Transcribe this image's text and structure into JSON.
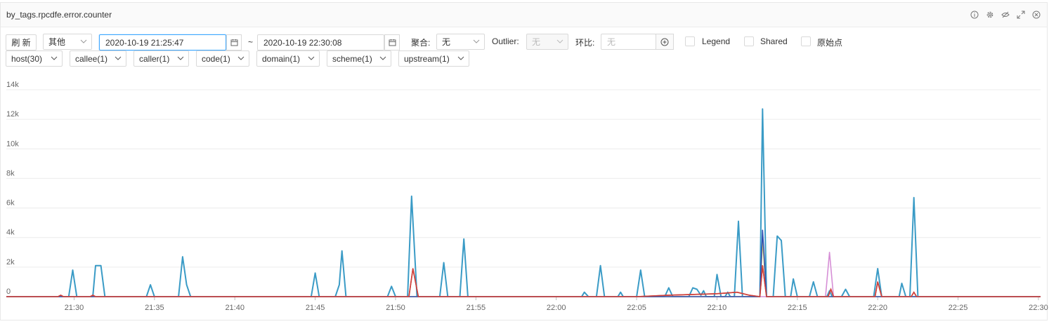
{
  "panel": {
    "title": "by_tags.rpcdfe.error.counter",
    "header_icons": [
      "info-icon",
      "gear-icon",
      "eye-off-icon",
      "expand-icon",
      "close-icon"
    ]
  },
  "toolbar": {
    "refresh_label": "刷 新",
    "type_select": "其他",
    "start_time": "2020-10-19 21:25:47",
    "separator": "~",
    "end_time": "2020-10-19 22:30:08",
    "agg_label": "聚合:",
    "agg_value": "无",
    "outlier_label": "Outlier:",
    "outlier_value": "无",
    "ratio_label": "环比:",
    "ratio_placeholder": "无",
    "legend_label": "Legend",
    "shared_label": "Shared",
    "raw_label": "原始点"
  },
  "filters": [
    "host(30)",
    "callee(1)",
    "caller(1)",
    "code(1)",
    "domain(1)",
    "scheme(1)",
    "upstream(1)"
  ],
  "colors": {
    "accent": "#40a9ff",
    "series_blue": "#3a9bc6",
    "series_red": "#d0403a",
    "series_pink": "#d68fd6",
    "series_yellow": "#e8d05a",
    "grid": "#ececec"
  },
  "chart_data": {
    "type": "line",
    "y_ticks": [
      "0",
      "2k",
      "4k",
      "6k",
      "8k",
      "10k",
      "12k",
      "14k"
    ],
    "x_ticks": [
      "21:30",
      "21:35",
      "21:40",
      "21:45",
      "21:50",
      "21:55",
      "22:00",
      "22:05",
      "22:10",
      "22:15",
      "22:20",
      "22:25",
      "22:30"
    ],
    "xlim": [
      "21:25:47",
      "22:30:08"
    ],
    "ylim": [
      0,
      14000
    ],
    "grid": true,
    "series": [
      {
        "color": "#3a9bc6",
        "points": [
          [
            "21:25:47",
            0
          ],
          [
            "21:29:40",
            0
          ],
          [
            "21:29:55",
            1800
          ],
          [
            "21:30:10",
            0
          ],
          [
            "21:31:10",
            0
          ],
          [
            "21:31:20",
            2100
          ],
          [
            "21:31:40",
            2100
          ],
          [
            "21:31:55",
            0
          ],
          [
            "21:34:30",
            0
          ],
          [
            "21:34:45",
            800
          ],
          [
            "21:35:00",
            0
          ],
          [
            "21:36:30",
            0
          ],
          [
            "21:36:45",
            2700
          ],
          [
            "21:37:00",
            800
          ],
          [
            "21:37:15",
            0
          ],
          [
            "21:44:45",
            0
          ],
          [
            "21:45:00",
            1600
          ],
          [
            "21:45:15",
            0
          ],
          [
            "21:46:15",
            0
          ],
          [
            "21:46:30",
            800
          ],
          [
            "21:46:40",
            3100
          ],
          [
            "21:46:55",
            0
          ],
          [
            "21:49:30",
            0
          ],
          [
            "21:49:45",
            700
          ],
          [
            "21:50:00",
            0
          ],
          [
            "21:50:45",
            0
          ],
          [
            "21:51:00",
            6800
          ],
          [
            "21:51:20",
            0
          ],
          [
            "21:52:45",
            0
          ],
          [
            "21:53:00",
            2300
          ],
          [
            "21:53:15",
            0
          ],
          [
            "21:54:00",
            0
          ],
          [
            "21:54:15",
            3900
          ],
          [
            "21:54:30",
            0
          ],
          [
            "22:01:35",
            0
          ],
          [
            "22:01:45",
            300
          ],
          [
            "22:02:00",
            0
          ],
          [
            "22:02:30",
            0
          ],
          [
            "22:02:45",
            2100
          ],
          [
            "22:03:00",
            0
          ],
          [
            "22:03:50",
            0
          ],
          [
            "22:04:00",
            300
          ],
          [
            "22:04:10",
            0
          ],
          [
            "22:05:00",
            0
          ],
          [
            "22:05:15",
            1800
          ],
          [
            "22:05:30",
            0
          ],
          [
            "22:06:45",
            0
          ],
          [
            "22:07:00",
            600
          ],
          [
            "22:07:15",
            0
          ],
          [
            "22:08:15",
            0
          ],
          [
            "22:08:30",
            600
          ],
          [
            "22:08:45",
            500
          ],
          [
            "22:09:00",
            100
          ],
          [
            "22:09:10",
            400
          ],
          [
            "22:09:20",
            0
          ],
          [
            "22:09:50",
            0
          ],
          [
            "22:10:00",
            1500
          ],
          [
            "22:10:15",
            0
          ],
          [
            "22:10:30",
            0
          ],
          [
            "22:10:40",
            300
          ],
          [
            "22:10:50",
            0
          ],
          [
            "22:11:05",
            0
          ],
          [
            "22:11:20",
            5100
          ],
          [
            "22:11:35",
            0
          ],
          [
            "22:12:40",
            0
          ],
          [
            "22:12:50",
            12700
          ],
          [
            "22:13:05",
            0
          ],
          [
            "22:13:30",
            0
          ],
          [
            "22:13:45",
            4100
          ],
          [
            "22:14:00",
            3800
          ],
          [
            "22:14:15",
            0
          ],
          [
            "22:14:35",
            0
          ],
          [
            "22:14:45",
            1200
          ],
          [
            "22:15:00",
            0
          ],
          [
            "22:15:45",
            0
          ],
          [
            "22:16:00",
            1000
          ],
          [
            "22:16:15",
            0
          ],
          [
            "22:16:50",
            0
          ],
          [
            "22:17:00",
            400
          ],
          [
            "22:17:10",
            0
          ],
          [
            "22:17:45",
            0
          ],
          [
            "22:18:00",
            500
          ],
          [
            "22:18:15",
            0
          ],
          [
            "22:19:45",
            0
          ],
          [
            "22:20:00",
            1900
          ],
          [
            "22:20:15",
            0
          ],
          [
            "22:21:20",
            0
          ],
          [
            "22:21:30",
            900
          ],
          [
            "22:21:45",
            0
          ],
          [
            "22:22:00",
            0
          ],
          [
            "22:22:15",
            6700
          ],
          [
            "22:22:30",
            0
          ],
          [
            "22:30:08",
            0
          ]
        ]
      },
      {
        "color": "#d0403a",
        "points": [
          [
            "21:25:47",
            0
          ],
          [
            "21:29:00",
            0
          ],
          [
            "21:29:10",
            100
          ],
          [
            "21:29:20",
            0
          ],
          [
            "21:31:00",
            0
          ],
          [
            "21:31:10",
            100
          ],
          [
            "21:31:20",
            0
          ],
          [
            "21:50:50",
            0
          ],
          [
            "21:51:05",
            1900
          ],
          [
            "21:51:25",
            0
          ],
          [
            "22:05:00",
            0
          ],
          [
            "22:07:00",
            100
          ],
          [
            "22:10:00",
            200
          ],
          [
            "22:11:15",
            300
          ],
          [
            "22:12:00",
            100
          ],
          [
            "22:12:40",
            0
          ],
          [
            "22:12:50",
            2100
          ],
          [
            "22:13:05",
            0
          ],
          [
            "22:16:55",
            0
          ],
          [
            "22:17:05",
            500
          ],
          [
            "22:17:15",
            0
          ],
          [
            "22:19:50",
            0
          ],
          [
            "22:20:00",
            1000
          ],
          [
            "22:20:15",
            0
          ],
          [
            "22:22:05",
            0
          ],
          [
            "22:22:15",
            300
          ],
          [
            "22:22:25",
            0
          ],
          [
            "22:30:08",
            0
          ]
        ]
      },
      {
        "color": "#d68fd6",
        "points": [
          [
            "21:25:47",
            0
          ],
          [
            "22:16:45",
            0
          ],
          [
            "22:17:00",
            3000
          ],
          [
            "22:17:15",
            0
          ],
          [
            "22:30:08",
            0
          ]
        ]
      },
      {
        "color": "#e8d05a",
        "points": [
          [
            "21:25:47",
            0
          ],
          [
            "22:12:40",
            0
          ],
          [
            "22:12:50",
            3800
          ],
          [
            "22:13:05",
            0
          ],
          [
            "22:30:08",
            0
          ]
        ]
      },
      {
        "color": "#2f4fb0",
        "points": [
          [
            "21:25:47",
            0
          ],
          [
            "22:12:40",
            0
          ],
          [
            "22:12:50",
            4500
          ],
          [
            "22:13:05",
            0
          ],
          [
            "22:30:08",
            0
          ]
        ]
      }
    ]
  }
}
